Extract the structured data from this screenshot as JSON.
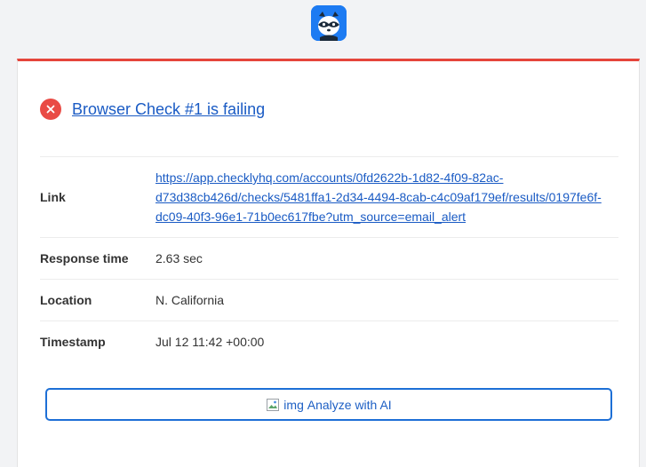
{
  "brand": {
    "logo_icon": "raccoon-logo-icon",
    "logo_color": "#1d7bf2"
  },
  "alert": {
    "status_color": "#e5453b",
    "status_icon": "close-icon",
    "title": "Browser Check #1 is failing"
  },
  "details": {
    "link": {
      "label": "Link",
      "url_line1": "https://app.checklyhq.com/accounts/0fd2622b-1d82-4f09-82ac-",
      "url_line2": "d73d38cb426d/checks/5481ffa1-2d34-4494-8cab-c4c09af179ef/results/0197fe6f-",
      "url_line3": "dc09-40f3-96e1-71b0ec617fbe?utm_source=email_alert"
    },
    "response_time": {
      "label": "Response time",
      "value": "2.63 sec"
    },
    "location": {
      "label": "Location",
      "value": "N. California"
    },
    "timestamp": {
      "label": "Timestamp",
      "value": "Jul 12 11:42 +00:00"
    }
  },
  "action": {
    "img_alt": "img",
    "label": "Analyze with AI",
    "accent": "#1d6fd6"
  }
}
